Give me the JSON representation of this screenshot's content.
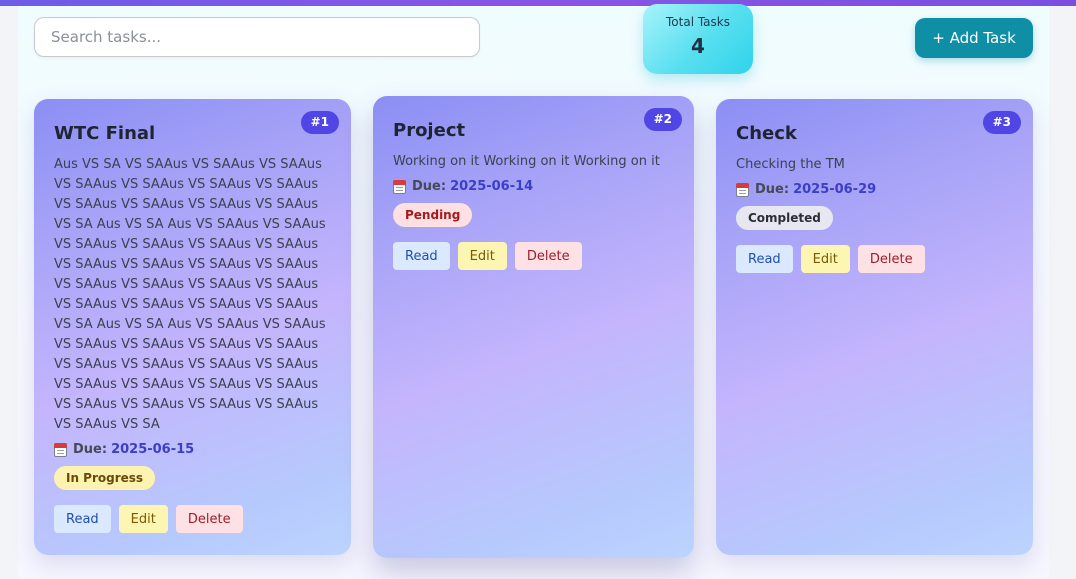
{
  "search": {
    "placeholder": "Search tasks..."
  },
  "stats": {
    "label": "Total Tasks",
    "value": "4"
  },
  "add_button": {
    "label": "+ Add Task"
  },
  "actions": {
    "read": "Read",
    "edit": "Edit",
    "delete": "Delete"
  },
  "due_label": "Due:",
  "colors": {
    "accent": "#4f46e5",
    "add_button": "#0e8fa6"
  },
  "tasks": [
    {
      "number": "#1",
      "title": "WTC Final",
      "description": "Aus VS SA VS SAAus VS SAAus VS SAAus VS SAAus VS SAAus VS SAAus VS SAAus VS SAAus VS SAAus VS SAAus VS SAAus VS SA Aus VS SA Aus VS SAAus VS SAAus VS SAAus VS SAAus VS SAAus VS SAAus VS SAAus VS SAAus VS SAAus VS SAAus VS SAAus VS SAAus VS SAAus VS SAAus VS SAAus VS SAAus VS SAAus VS SAAus VS SA Aus VS SA Aus VS SAAus VS SAAus VS SAAus VS SAAus VS SAAus VS SAAus VS SAAus VS SAAus VS SAAus VS SAAus VS SAAus VS SAAus VS SAAus VS SAAus VS SAAus VS SAAus VS SAAus VS SAAus VS SAAus VS SA",
      "due": "2025-06-15",
      "status": "In Progress"
    },
    {
      "number": "#2",
      "title": "Project",
      "description": "Working on it Working on it Working on it",
      "due": "2025-06-14",
      "status": "Pending"
    },
    {
      "number": "#3",
      "title": "Check",
      "description": "Checking the TM",
      "due": "2025-06-29",
      "status": "Completed"
    }
  ]
}
